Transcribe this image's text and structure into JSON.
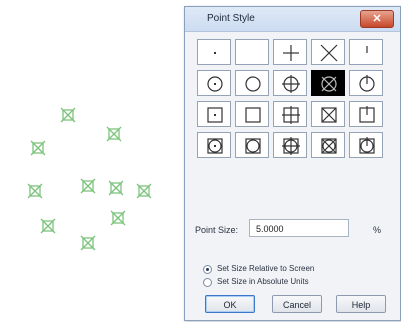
{
  "dialog": {
    "title": "Point Style",
    "close_label": "✕",
    "point_size_label": "Point Size:",
    "point_size_value": "5.0000",
    "percent_symbol": "%",
    "radio_relative": "Set Size Relative to Screen",
    "radio_absolute": "Set Size in Absolute Units",
    "selected_radio": "relative",
    "ok_label": "OK",
    "cancel_label": "Cancel",
    "help_label": "Help"
  },
  "styles": [
    {
      "name": "style-dot"
    },
    {
      "name": "style-none"
    },
    {
      "name": "style-plus"
    },
    {
      "name": "style-x"
    },
    {
      "name": "style-tick"
    },
    {
      "name": "style-circle-dot"
    },
    {
      "name": "style-circle"
    },
    {
      "name": "style-circle-plus"
    },
    {
      "name": "style-circle-x",
      "selected": true
    },
    {
      "name": "style-circle-tick"
    },
    {
      "name": "style-square-dot"
    },
    {
      "name": "style-square"
    },
    {
      "name": "style-square-plus"
    },
    {
      "name": "style-square-x"
    },
    {
      "name": "style-square-tick"
    },
    {
      "name": "style-square-circle-dot"
    },
    {
      "name": "style-square-circle"
    },
    {
      "name": "style-square-circle-plus"
    },
    {
      "name": "style-square-circle-x"
    },
    {
      "name": "style-square-circle-tick"
    }
  ],
  "colors": {
    "point_marker": "#7cc47c",
    "selected_cell": "#000000"
  }
}
